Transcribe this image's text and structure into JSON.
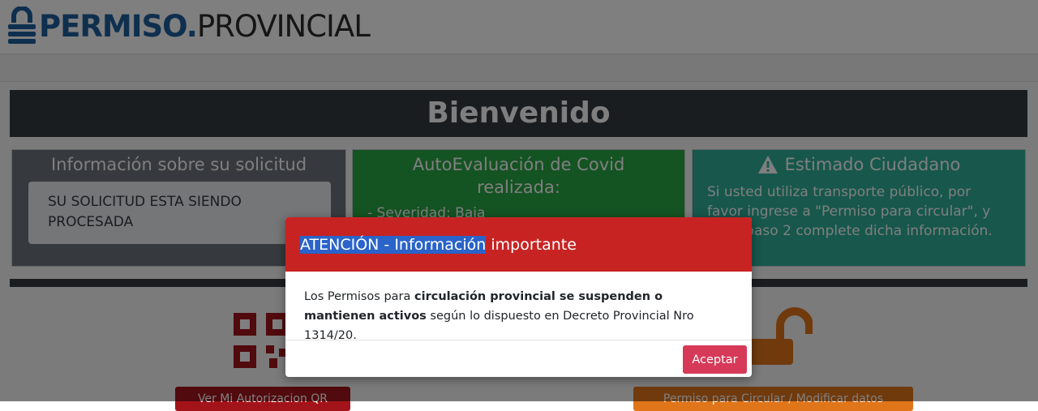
{
  "logo": {
    "strong": "PERMISO",
    "dot": ".",
    "light": "PROVINCIAL"
  },
  "welcome": {
    "title": "Bienvenido"
  },
  "boxes": {
    "request": {
      "title": "Información sobre su solicitud",
      "status": "SU SOLICITUD ESTA SIENDO PROCESADA"
    },
    "covid": {
      "title": "AutoEvaluación de Covid realizada:",
      "item": "- Severidad: Baja"
    },
    "citizen": {
      "title": "Estimado Ciudadano",
      "text": "Si usted utiliza transporte público, por favor ingrese a \"Permiso para circular\", y en el paso 2 complete dicha información."
    }
  },
  "buttons": {
    "qr": "Ver Mi Autorizacion QR",
    "permit": "Permiso para Circular / Modificar datos"
  },
  "modal": {
    "title_selected": "ATENCIÓN - Información",
    "title_rest": " importante",
    "body_1": "Los Permisos para ",
    "body_bold": "circulación provincial se suspenden o mantienen activos",
    "body_2": " según lo dispuesto en Decreto Provincial Nro 1314/20.",
    "accept": "Aceptar"
  },
  "colors": {
    "modal_header": "#c82323",
    "accept_button": "#d63a58",
    "logo_blue": "#1f5f9e",
    "welcome_bar": "#343a40",
    "covid_box": "#28a745",
    "citizen_box": "#2fae99"
  },
  "icons": {
    "logo": "lock-icon",
    "warning": "warning-icon",
    "qr": "qr-code-icon",
    "unlock": "unlock-icon"
  }
}
